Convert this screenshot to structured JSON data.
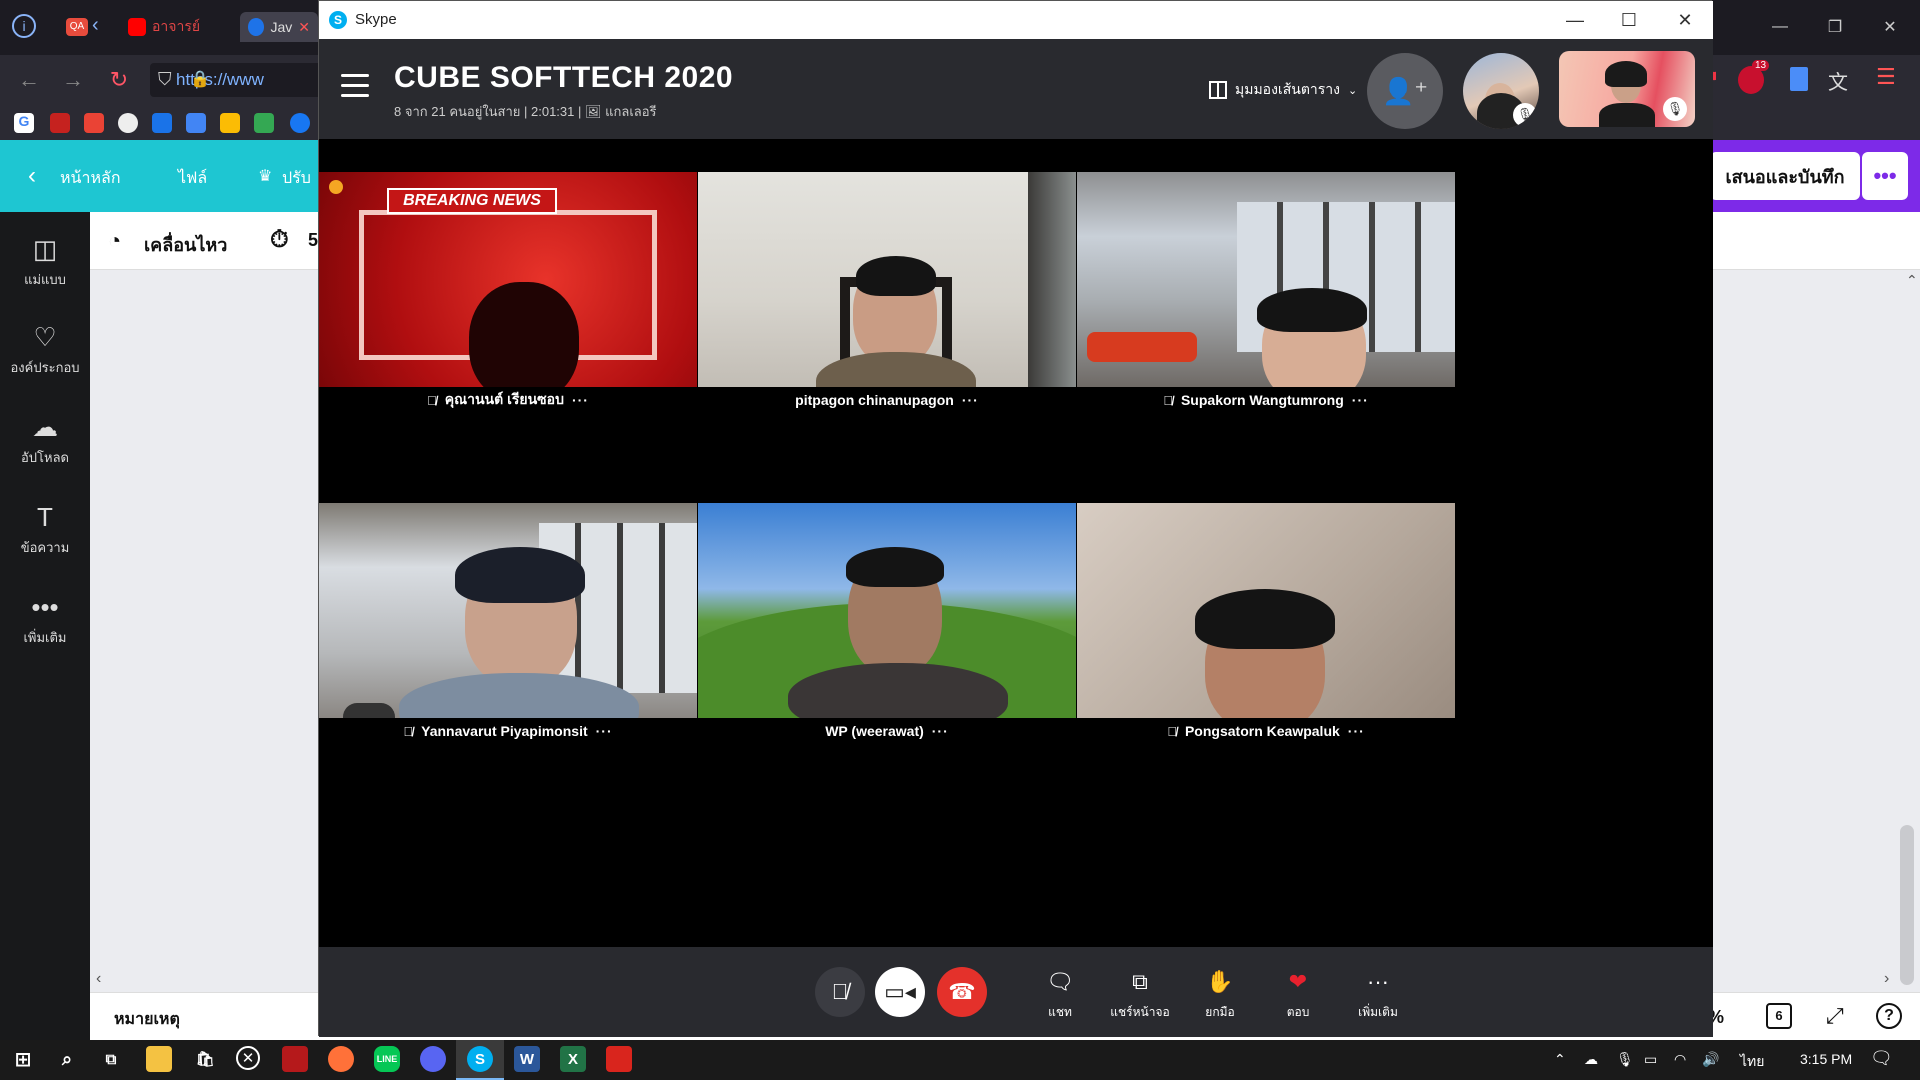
{
  "browser": {
    "tabs": [
      {
        "label": "QA",
        "color": "#e84c3d"
      },
      {
        "label": "อาจารย์",
        "color": "#ff0000"
      },
      {
        "label": "Jav",
        "color": "#1e73e8"
      }
    ],
    "url": "https://www",
    "notification_count": "13"
  },
  "canva": {
    "nav": {
      "home": "หน้าหลัก",
      "file": "ไฟล์",
      "resize": "ปรับ"
    },
    "present_button": "เสนอและบันทึก",
    "more_button": "•••",
    "toolstrip": {
      "motion": "เคลื่อนไหว",
      "timer": "5"
    },
    "sidebar": [
      {
        "label": "แม่แบบ",
        "icon": "template-icon"
      },
      {
        "label": "องค์ประกอบ",
        "icon": "elements-icon"
      },
      {
        "label": "อัปโหลด",
        "icon": "upload-icon"
      },
      {
        "label": "ข้อความ",
        "icon": "text-icon"
      },
      {
        "label": "เพิ่มเติม",
        "icon": "more-icon"
      }
    ],
    "notes": "หมายเหตุ",
    "zoom_suffix": "%",
    "page_count": "6"
  },
  "skype": {
    "window_title": "Skype",
    "call_title": "CUBE SOFTTECH 2020",
    "subtitle": "8 จาก 21 คนอยู่ในสาย | 2:01:31 | 🖼 แกลเลอรี",
    "view_mode": "มุมมองเส้นตาราง",
    "participants": [
      {
        "name": "คุณานนต์ เรียนซอบ",
        "muted": true,
        "bg": "breaking-news"
      },
      {
        "name": "pitpagon chinanupagon",
        "muted": false,
        "bg": "room"
      },
      {
        "name": "Supakorn Wangtumrong",
        "muted": true,
        "bg": "loft"
      },
      {
        "name": "Yannavarut Piyapimonsit",
        "muted": true,
        "bg": "loft"
      },
      {
        "name": "WP (weerawat)",
        "muted": false,
        "bg": "bliss"
      },
      {
        "name": "Pongsatorn Keawpaluk",
        "muted": true,
        "bg": "plain"
      }
    ],
    "tile_badge": "BREAKING NEWS",
    "controls": {
      "chat": "แชท",
      "share": "แชร์หน้าจอ",
      "raise_hand": "ยกมือ",
      "react": "ตอบ",
      "more": "เพิ่มเติม"
    }
  },
  "taskbar": {
    "language": "ไทย",
    "time": "3:15 PM"
  }
}
